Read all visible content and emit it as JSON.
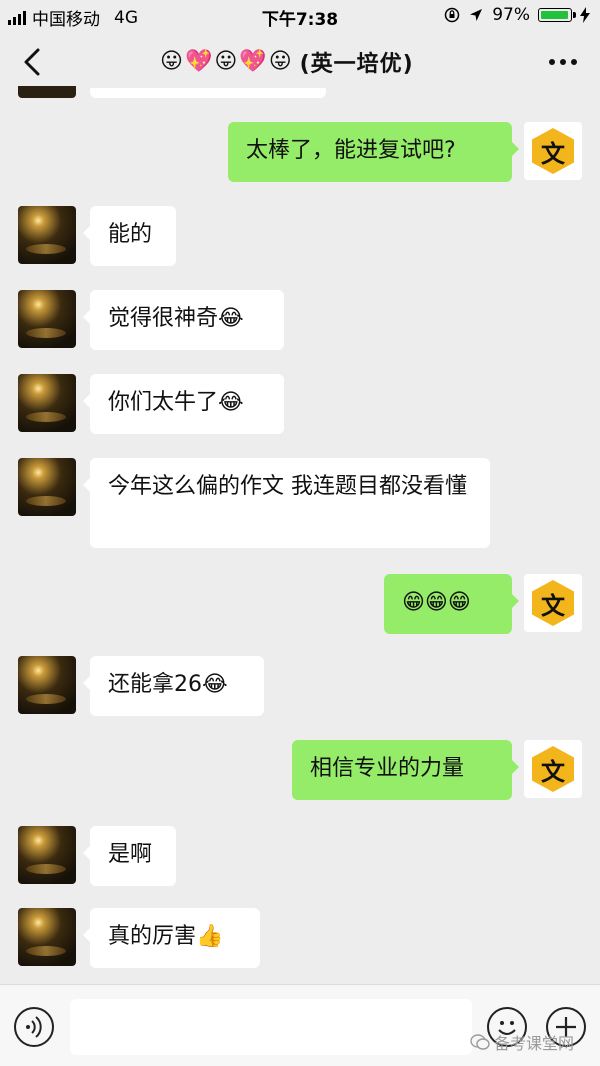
{
  "status_bar": {
    "carrier": "中国移动",
    "network": "4G",
    "time": "下午7:38",
    "battery": "97%",
    "battery_level": 0.97,
    "battery_color": "#22c33a"
  },
  "header": {
    "title_emojis": [
      "😛",
      "💖",
      "😛",
      "💖",
      "😛"
    ],
    "title_text": "(英一培优)",
    "back_icon": "chevron-left-icon",
    "more_icon": "more-dots-icon"
  },
  "messages": [
    {
      "side": "right",
      "text": "太棒了，能进复试吧?",
      "avatar": "文"
    },
    {
      "side": "left",
      "text": "能的"
    },
    {
      "side": "left",
      "text": "觉得很神奇😂"
    },
    {
      "side": "left",
      "text": "你们太牛了😂"
    },
    {
      "side": "left",
      "text": "今年这么偏的作文 我连题目都没看懂"
    },
    {
      "side": "right",
      "text": "😁😁😁",
      "avatar": "文"
    },
    {
      "side": "left",
      "text": "还能拿26😂"
    },
    {
      "side": "right",
      "text": "相信专业的力量",
      "avatar": "文"
    },
    {
      "side": "left",
      "text": "是啊"
    },
    {
      "side": "left",
      "text": "真的厉害👍"
    }
  ],
  "input_bar": {
    "voice_icon": "voice-icon",
    "emoji_icon": "emoji-icon",
    "plus_icon": "plus-icon",
    "watermark": "备考课堂网"
  },
  "colors": {
    "background": "#ededed",
    "bubble_right": "#95ec69",
    "bubble_left": "#ffffff",
    "avatar_hex": "#f2b51b"
  }
}
